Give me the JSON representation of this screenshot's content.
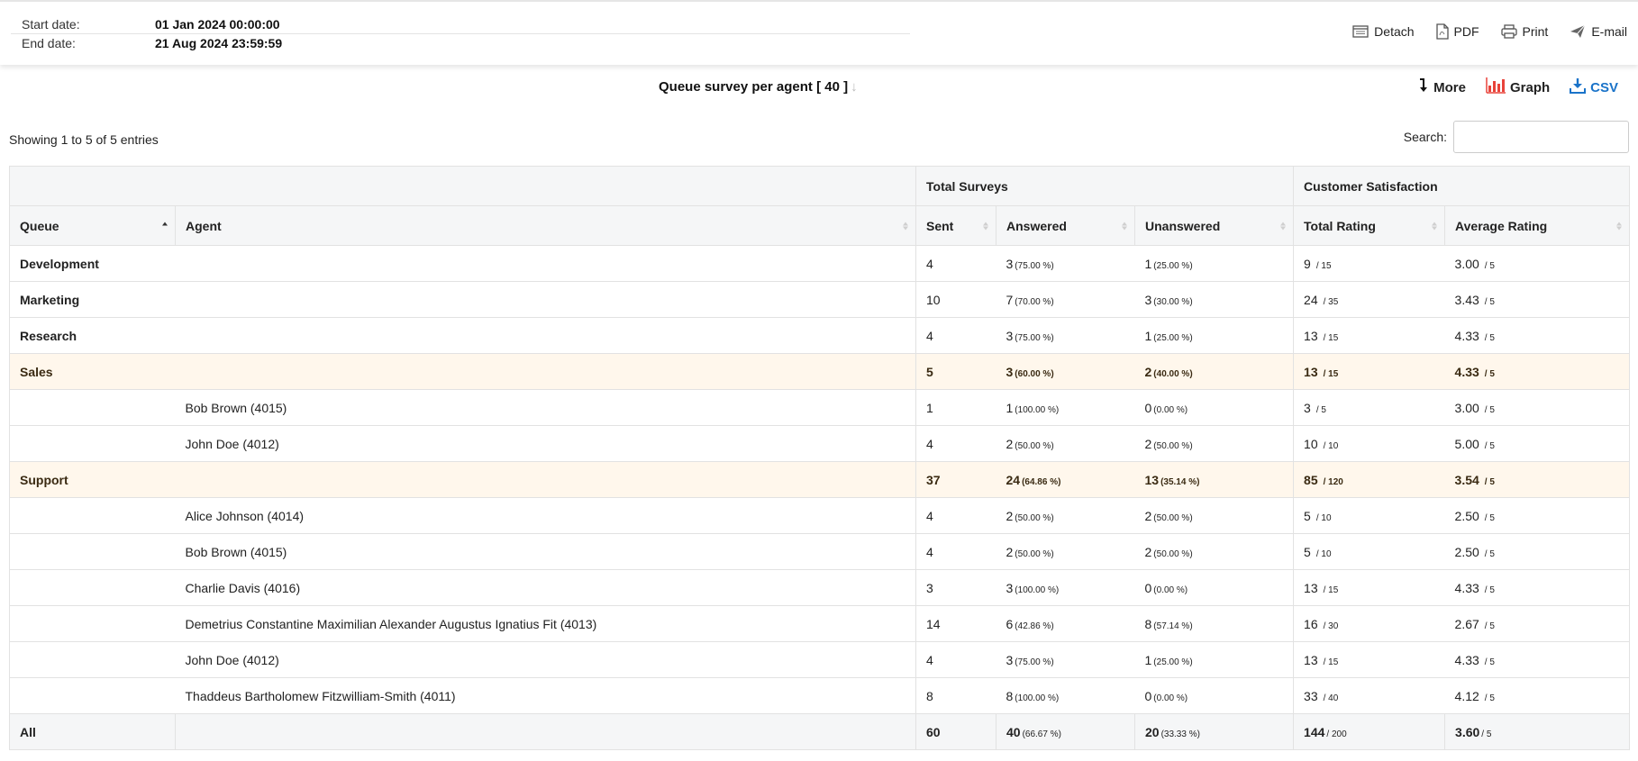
{
  "header": {
    "start_label": "Start date:",
    "start_value": "01 Jan 2024 00:00:00",
    "end_label": "End date:",
    "end_value": "21 Aug 2024 23:59:59",
    "actions": {
      "detach": "Detach",
      "pdf": "PDF",
      "print": "Print",
      "email": "E-mail"
    }
  },
  "report": {
    "title": "Queue survey per agent [ 40 ]",
    "more_label": "More",
    "graph_label": "Graph",
    "csv_label": "CSV",
    "showing_text": "Showing 1 to 5 of 5 entries",
    "search_label": "Search:",
    "search_value": ""
  },
  "colors": {
    "highlight_row": "#fff7ec",
    "csv_link": "#1a73c9",
    "graph_icon": "#e8433a"
  },
  "table": {
    "group_headers": {
      "total_surveys": "Total Surveys",
      "customer_satisfaction": "Customer Satisfaction"
    },
    "columns": {
      "queue": "Queue",
      "agent": "Agent",
      "sent": "Sent",
      "answered": "Answered",
      "unanswered": "Unanswered",
      "total_rating": "Total Rating",
      "average_rating": "Average Rating"
    },
    "rows": [
      {
        "queue": "Development",
        "agent": "",
        "sent": "4",
        "ans": "3",
        "ans_pct": "(75.00 %)",
        "unans": "1",
        "unans_pct": "(25.00 %)",
        "tr": "9",
        "tr_max": "/ 15",
        "avg": "3.00",
        "avg_max": "/ 5"
      },
      {
        "queue": "Marketing",
        "agent": "",
        "sent": "10",
        "ans": "7",
        "ans_pct": "(70.00 %)",
        "unans": "3",
        "unans_pct": "(30.00 %)",
        "tr": "24",
        "tr_max": "/ 35",
        "avg": "3.43",
        "avg_max": "/ 5"
      },
      {
        "queue": "Research",
        "agent": "",
        "sent": "4",
        "ans": "3",
        "ans_pct": "(75.00 %)",
        "unans": "1",
        "unans_pct": "(25.00 %)",
        "tr": "13",
        "tr_max": "/ 15",
        "avg": "4.33",
        "avg_max": "/ 5"
      },
      {
        "queue": "Sales",
        "agent": "",
        "sent": "5",
        "ans": "3",
        "ans_pct": "(60.00 %)",
        "unans": "2",
        "unans_pct": "(40.00 %)",
        "tr": "13",
        "tr_max": "/ 15",
        "avg": "4.33",
        "avg_max": "/ 5"
      },
      {
        "queue": "",
        "agent": "Bob Brown (4015)",
        "sent": "1",
        "ans": "1",
        "ans_pct": "(100.00 %)",
        "unans": "0",
        "unans_pct": "(0.00 %)",
        "tr": "3",
        "tr_max": "/ 5",
        "avg": "3.00",
        "avg_max": "/ 5"
      },
      {
        "queue": "",
        "agent": "John Doe (4012)",
        "sent": "4",
        "ans": "2",
        "ans_pct": "(50.00 %)",
        "unans": "2",
        "unans_pct": "(50.00 %)",
        "tr": "10",
        "tr_max": "/ 10",
        "avg": "5.00",
        "avg_max": "/ 5"
      },
      {
        "queue": "Support",
        "agent": "",
        "sent": "37",
        "ans": "24",
        "ans_pct": "(64.86 %)",
        "unans": "13",
        "unans_pct": "(35.14 %)",
        "tr": "85",
        "tr_max": "/ 120",
        "avg": "3.54",
        "avg_max": "/ 5"
      },
      {
        "queue": "",
        "agent": "Alice Johnson (4014)",
        "sent": "4",
        "ans": "2",
        "ans_pct": "(50.00 %)",
        "unans": "2",
        "unans_pct": "(50.00 %)",
        "tr": "5",
        "tr_max": "/ 10",
        "avg": "2.50",
        "avg_max": "/ 5"
      },
      {
        "queue": "",
        "agent": "Bob Brown (4015)",
        "sent": "4",
        "ans": "2",
        "ans_pct": "(50.00 %)",
        "unans": "2",
        "unans_pct": "(50.00 %)",
        "tr": "5",
        "tr_max": "/ 10",
        "avg": "2.50",
        "avg_max": "/ 5"
      },
      {
        "queue": "",
        "agent": "Charlie Davis (4016)",
        "sent": "3",
        "ans": "3",
        "ans_pct": "(100.00 %)",
        "unans": "0",
        "unans_pct": "(0.00 %)",
        "tr": "13",
        "tr_max": "/ 15",
        "avg": "4.33",
        "avg_max": "/ 5"
      },
      {
        "queue": "",
        "agent": "Demetrius Constantine Maximilian Alexander Augustus Ignatius Fit (4013)",
        "sent": "14",
        "ans": "6",
        "ans_pct": "(42.86 %)",
        "unans": "8",
        "unans_pct": "(57.14 %)",
        "tr": "16",
        "tr_max": "/ 30",
        "avg": "2.67",
        "avg_max": "/ 5"
      },
      {
        "queue": "",
        "agent": "John Doe (4012)",
        "sent": "4",
        "ans": "3",
        "ans_pct": "(75.00 %)",
        "unans": "1",
        "unans_pct": "(25.00 %)",
        "tr": "13",
        "tr_max": "/ 15",
        "avg": "4.33",
        "avg_max": "/ 5"
      },
      {
        "queue": "",
        "agent": "Thaddeus Bartholomew Fitzwilliam-Smith (4011)",
        "sent": "8",
        "ans": "8",
        "ans_pct": "(100.00 %)",
        "unans": "0",
        "unans_pct": "(0.00 %)",
        "tr": "33",
        "tr_max": "/ 40",
        "avg": "4.12",
        "avg_max": "/ 5"
      }
    ],
    "total": {
      "queue": "All",
      "agent": "",
      "sent": "60",
      "ans": "40",
      "ans_pct": "(66.67 %)",
      "unans": "20",
      "unans_pct": "(33.33 %)",
      "tr": "144",
      "tr_max": "/ 200",
      "avg": "3.60",
      "avg_max": "/ 5"
    }
  }
}
